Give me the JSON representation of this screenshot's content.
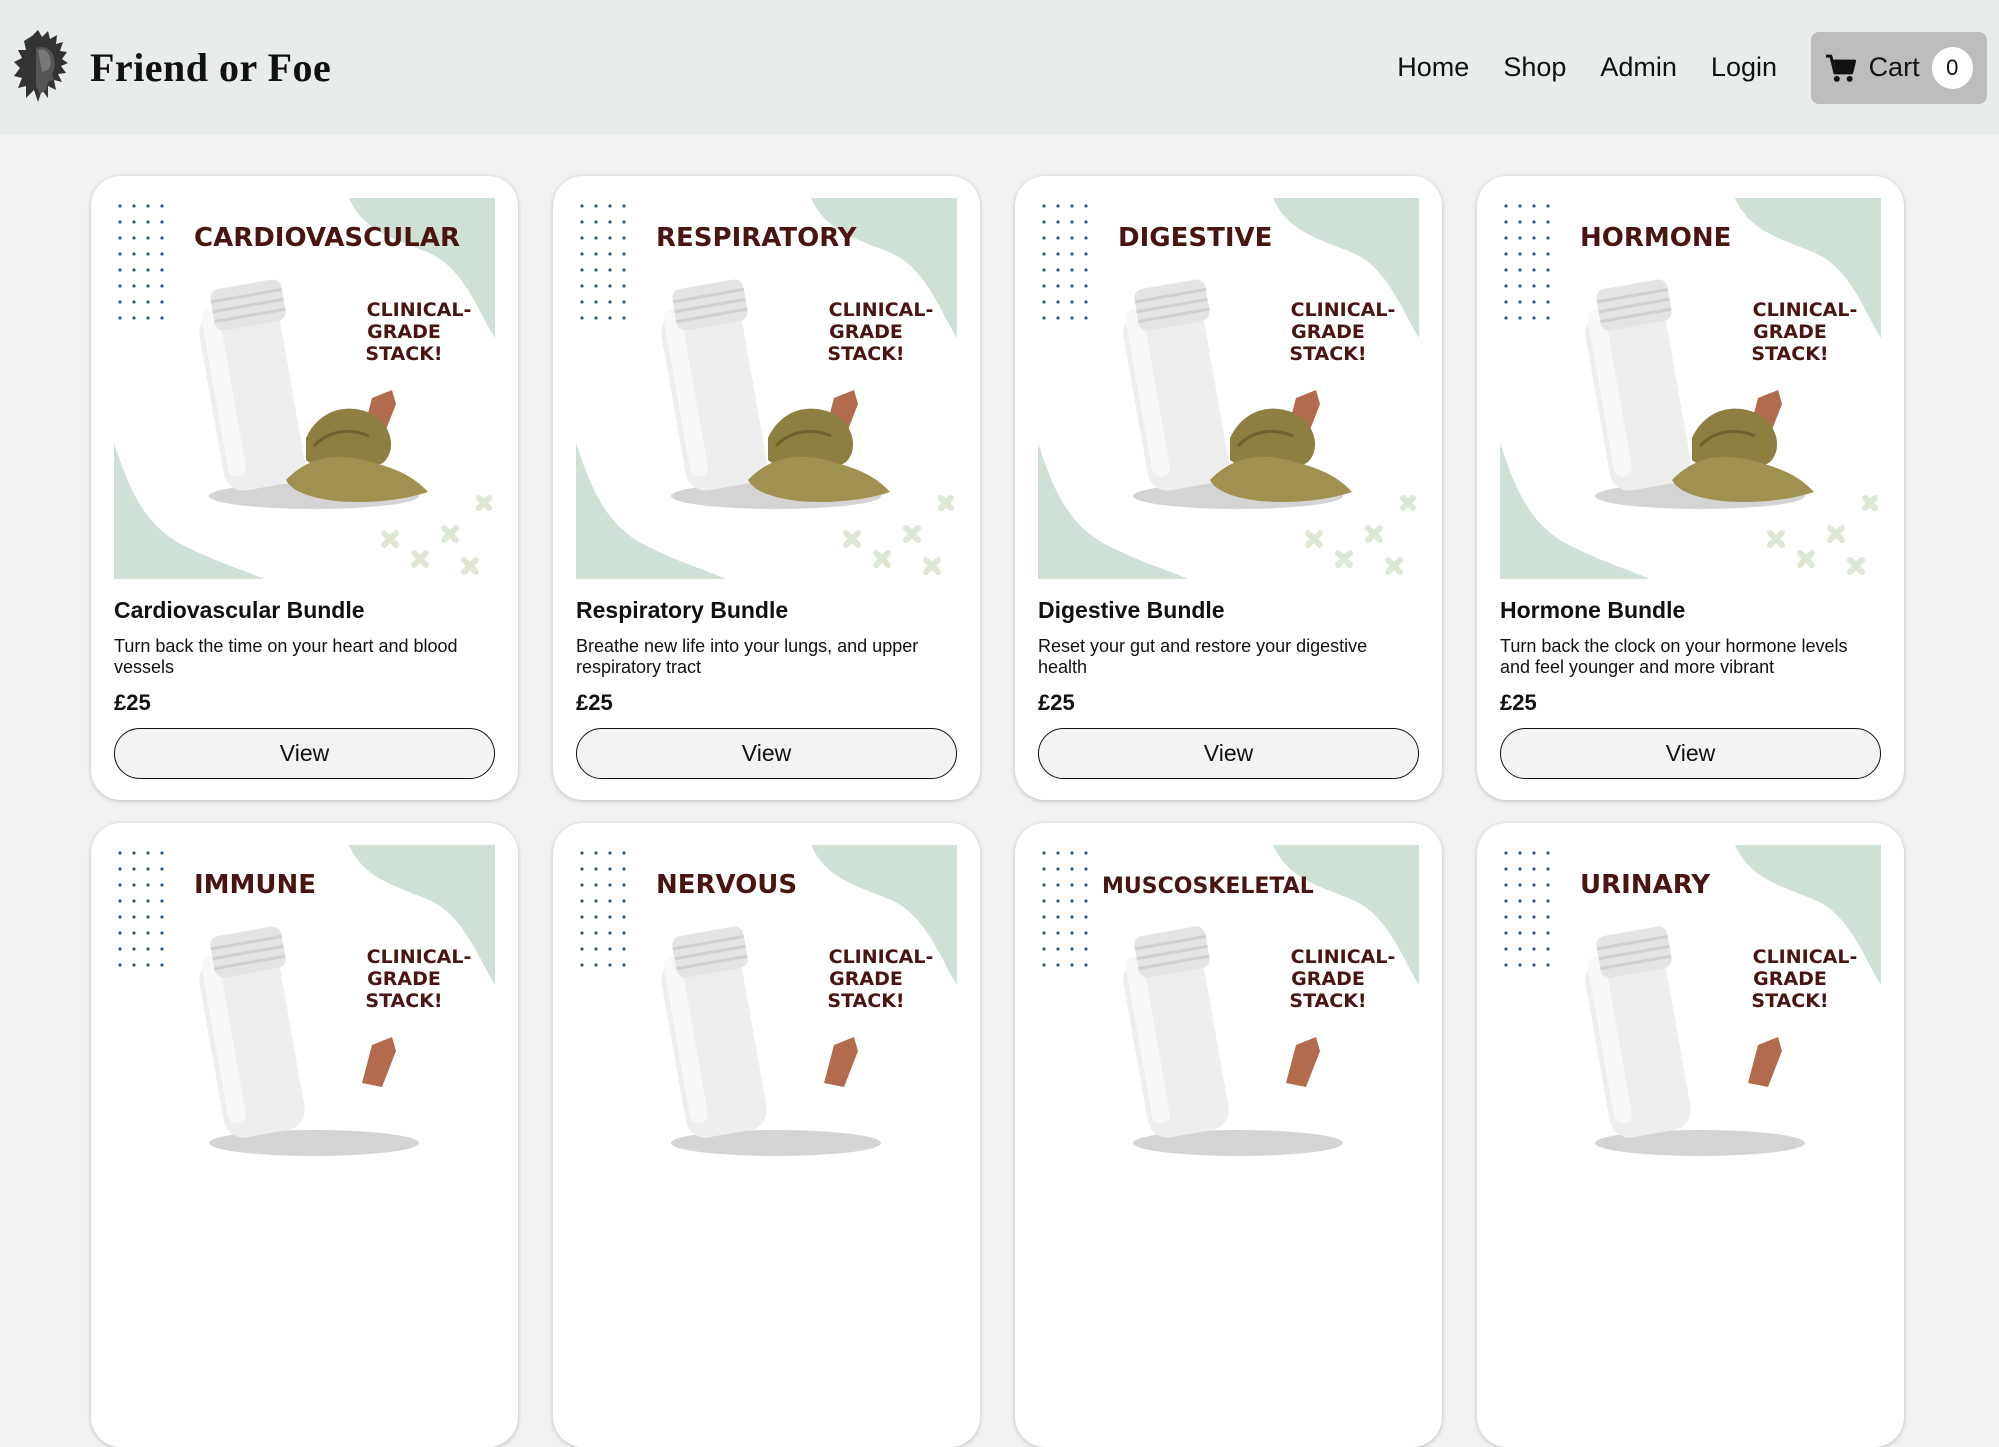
{
  "brand": {
    "name": "Friend or Foe",
    "logo_icon": "native-chief-headdress-logo"
  },
  "nav": {
    "home": "Home",
    "shop": "Shop",
    "admin": "Admin",
    "login": "Login",
    "cart_label": "Cart",
    "cart_count": "0",
    "cart_icon": "shopping-cart-icon"
  },
  "colors": {
    "navbar_bg": "#e8ecec",
    "cart_bg": "#bdbdbd",
    "wave_green": "#cfe1d4",
    "label_text": "#4a1511",
    "dots": "#2d5a87"
  },
  "products": [
    {
      "title": "Cardiovascular Bundle",
      "desc": "Turn back the time on your heart and blood vessels",
      "price": "£25",
      "button": "View",
      "img_word": "CARDIOVASCULAR",
      "tag1": "CLINICAL-",
      "tag2": "GRADE",
      "tag3": "STACK!"
    },
    {
      "title": "Respiratory Bundle",
      "desc": "Breathe new life into your lungs, and upper respiratory tract",
      "price": "£25",
      "button": "View",
      "img_word": "RESPIRATORY",
      "tag1": "CLINICAL-",
      "tag2": "GRADE",
      "tag3": "STACK!"
    },
    {
      "title": "Digestive Bundle",
      "desc": "Reset your gut and restore your digestive health",
      "price": "£25",
      "button": "View",
      "img_word": "DIGESTIVE",
      "tag1": "CLINICAL-",
      "tag2": "GRADE",
      "tag3": "STACK!"
    },
    {
      "title": "Hormone Bundle",
      "desc": "Turn back the clock on your hormone levels and feel younger and more vibrant",
      "price": "£25",
      "button": "View",
      "img_word": "HORMONE",
      "tag1": "CLINICAL-",
      "tag2": "GRADE",
      "tag3": "STACK!"
    },
    {
      "img_word": "IMMUNE",
      "tag1": "CLINICAL-",
      "tag2": "GRADE",
      "tag3": "STACK!"
    },
    {
      "img_word": "NERVOUS",
      "tag1": "CLINICAL-",
      "tag2": "GRADE",
      "tag3": "STACK!"
    },
    {
      "img_word": "MUSCOSKELETAL",
      "tag1": "CLINICAL-",
      "tag2": "GRADE",
      "tag3": "STACK!"
    },
    {
      "img_word": "URINARY",
      "tag1": "CLINICAL-",
      "tag2": "GRADE",
      "tag3": "STACK!"
    }
  ]
}
